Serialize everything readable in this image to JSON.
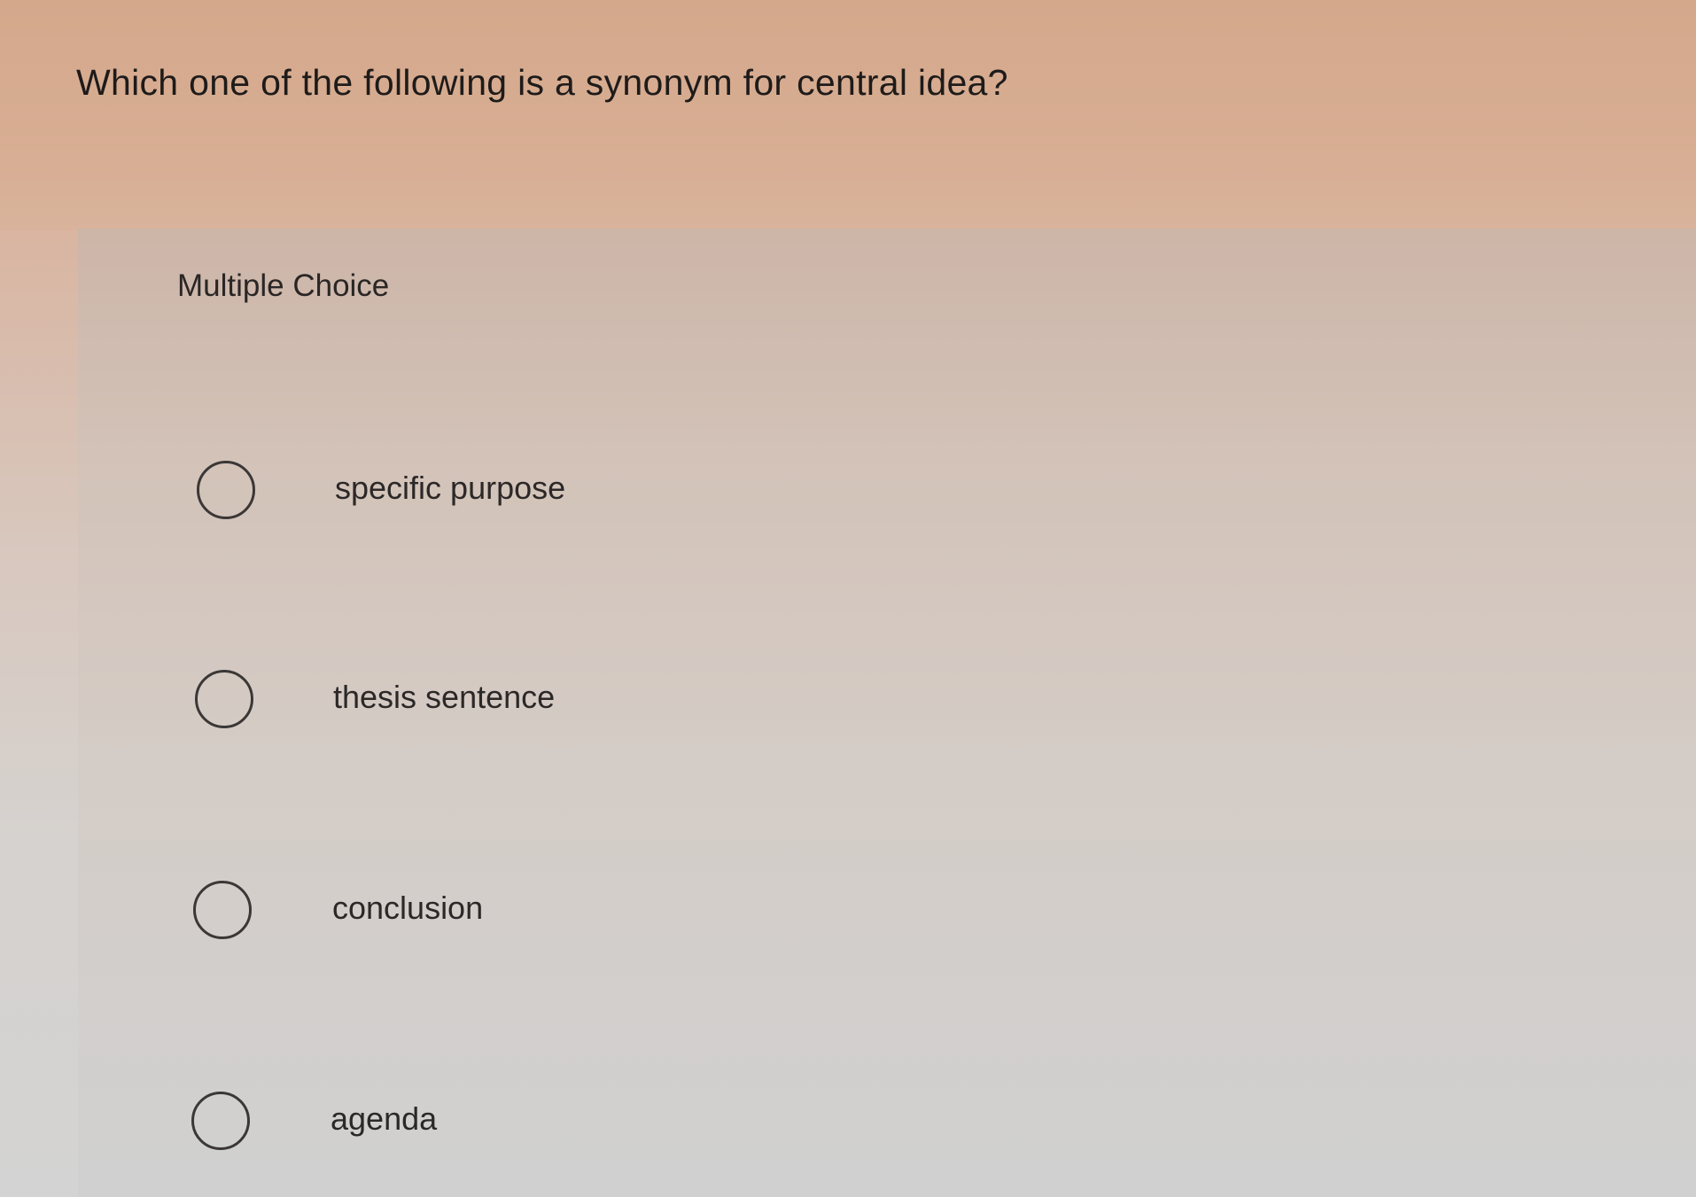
{
  "question": {
    "text": "Which one of the following is a synonym for central idea?"
  },
  "choice_panel": {
    "label": "Multiple Choice",
    "options": [
      {
        "label": "specific purpose",
        "selected": false
      },
      {
        "label": "thesis sentence",
        "selected": false
      },
      {
        "label": "conclusion",
        "selected": false
      },
      {
        "label": "agenda",
        "selected": false
      }
    ]
  },
  "colors": {
    "header_background": "#d6a98c",
    "panel_background": "#d3cdc9",
    "text": "#1e1b1a",
    "radio_border": "#3b3736"
  },
  "icons": {
    "option_radio": "radio-unchecked-icon"
  }
}
